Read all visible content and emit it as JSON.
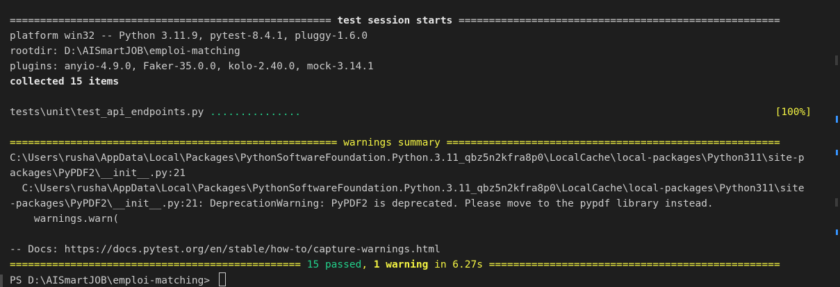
{
  "session_header": {
    "left_rule": "=====================================================",
    "title": "test session starts",
    "right_rule": "====================================================="
  },
  "platform_line": "platform win32 -- Python 3.11.9, pytest-8.4.1, pluggy-1.6.0",
  "rootdir_line": "rootdir: D:\\AISmartJOB\\emploi-matching",
  "plugins_line": "plugins: anyio-4.9.0, Faker-35.0.0, kolo-2.40.0, mock-3.14.1",
  "collected_line": "collected 15 items",
  "test_file": {
    "path": "tests\\unit\\test_api_endpoints.py",
    "dots": "...............",
    "percent": "[100%]"
  },
  "warnings_header": {
    "left_rule": "======================================================",
    "title": "warnings summary",
    "right_rule": "======================================================="
  },
  "warning_lines": [
    "C:\\Users\\rusha\\AppData\\Local\\Packages\\PythonSoftwareFoundation.Python.3.11_qbz5n2kfra8p0\\LocalCache\\local-packages\\Python311\\site-p",
    "ackages\\PyPDF2\\__init__.py:21",
    "  C:\\Users\\rusha\\AppData\\Local\\Packages\\PythonSoftwareFoundation.Python.3.11_qbz5n2kfra8p0\\LocalCache\\local-packages\\Python311\\site",
    "-packages\\PyPDF2\\__init__.py:21: DeprecationWarning: PyPDF2 is deprecated. Please move to the pypdf library instead.",
    "    warnings.warn("
  ],
  "docs_line": "-- Docs: https://docs.pytest.org/en/stable/how-to/capture-warnings.html",
  "summary": {
    "left_rule": "================================================",
    "passed": "15 passed",
    "sep": ", ",
    "warning": "1 warning",
    "time": " in 6.27s ",
    "right_rule": "================================================"
  },
  "prompt": "PS D:\\AISmartJOB\\emploi-matching> "
}
